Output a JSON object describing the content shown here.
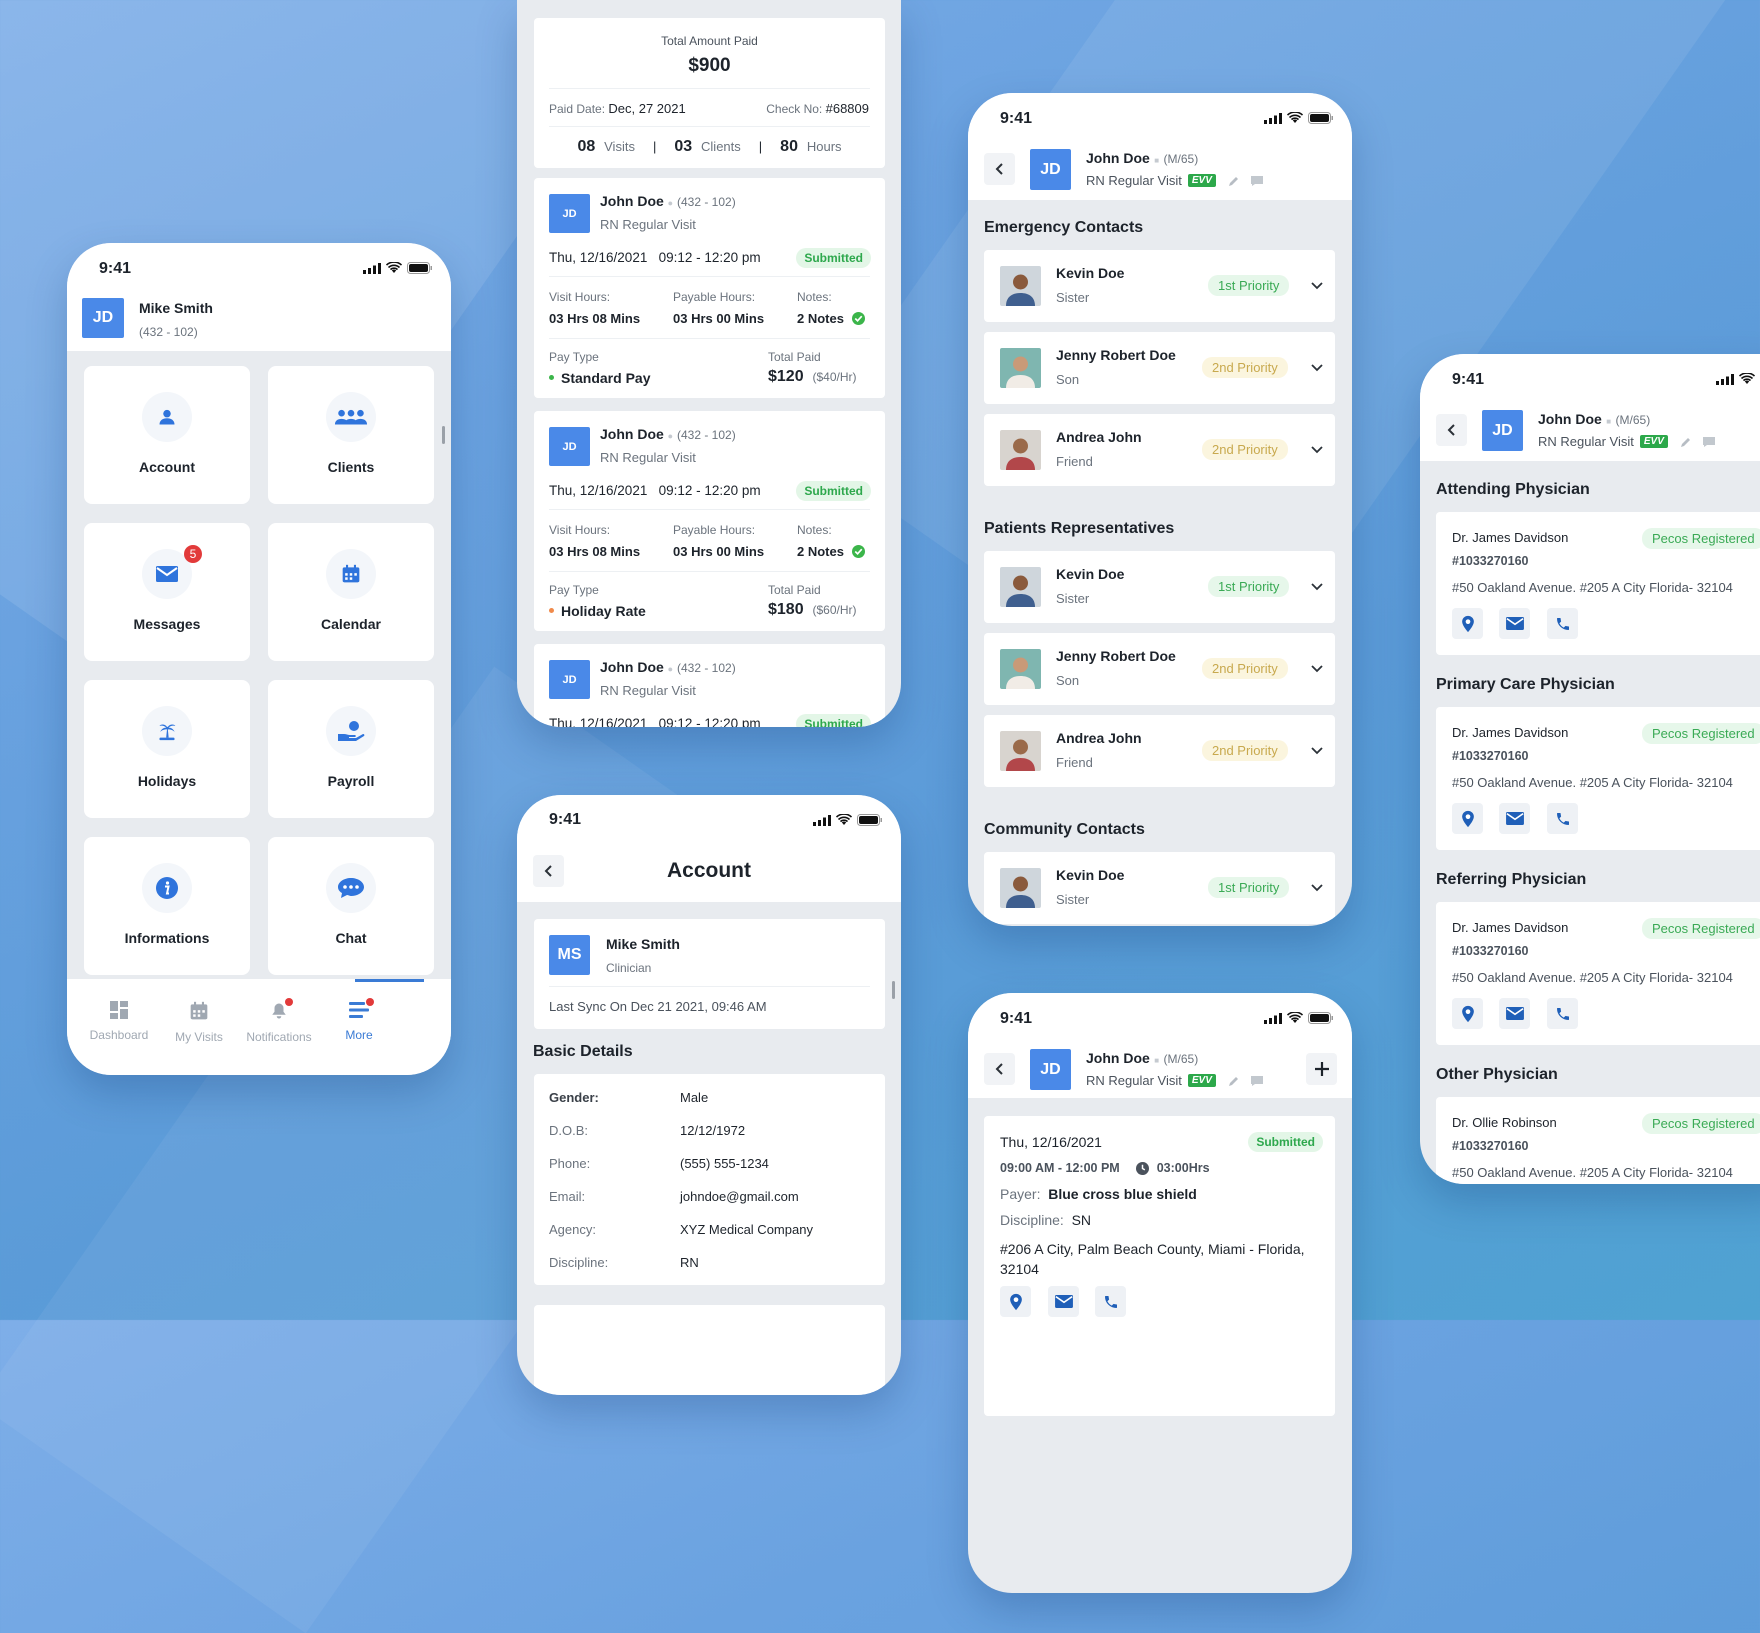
{
  "status_time": "9:41",
  "colors": {
    "accent": "#4a89e8",
    "icon_blue": "#2f74dc",
    "success": "#2ea84d",
    "warning": "#c8a94e",
    "badge_red": "#e23a3a",
    "nav_inactive": "#a0a8b2",
    "nav_active": "#3a7bd5"
  },
  "home": {
    "user": {
      "initials": "JD",
      "name": "Mike Smith",
      "id": "(432 - 102)"
    },
    "tiles": [
      {
        "label": "Account",
        "icon": "person"
      },
      {
        "label": "Clients",
        "icon": "people"
      },
      {
        "label": "Messages",
        "icon": "mail",
        "badge": "5"
      },
      {
        "label": "Calendar",
        "icon": "calendar"
      },
      {
        "label": "Holidays",
        "icon": "palm"
      },
      {
        "label": "Payroll",
        "icon": "hand-coin"
      },
      {
        "label": "Informations",
        "icon": "info"
      },
      {
        "label": "Chat",
        "icon": "chat"
      }
    ],
    "nav": [
      {
        "label": "Dashboard",
        "icon": "dashboard",
        "active": false
      },
      {
        "label": "My Visits",
        "icon": "calendar",
        "active": false
      },
      {
        "label": "Notifications",
        "icon": "bell",
        "active": false,
        "dot": true
      },
      {
        "label": "More",
        "icon": "menu",
        "active": true,
        "dot": true
      }
    ]
  },
  "payroll": {
    "summary": {
      "label": "Total Amount Paid",
      "amount": "$900",
      "paid_date_label": "Paid Date:",
      "paid_date": "Dec, 27 2021",
      "check_label": "Check No:",
      "check_no": "#68809",
      "stats": [
        {
          "value": "08",
          "label": "Visits"
        },
        {
          "value": "03",
          "label": "Clients"
        },
        {
          "value": "80",
          "label": "Hours"
        }
      ],
      "separator": "|"
    },
    "visits": [
      {
        "initials": "JD",
        "name": "John Doe",
        "id": "(432 - 102)",
        "type": "RN Regular Visit",
        "date": "Thu, 12/16/2021",
        "time": "09:12 - 12:20 pm",
        "status": "Submitted",
        "visit_hours_label": "Visit Hours:",
        "visit_hours": "03 Hrs 08 Mins",
        "payable_label": "Payable Hours:",
        "payable": "03 Hrs 00 Mins",
        "notes_label": "Notes:",
        "notes": "2 Notes",
        "pay_type_label": "Pay Type",
        "pay_type": "Standard Pay",
        "pay_type_color": "#3bb54a",
        "total_label": "Total Paid",
        "total": "$120",
        "rate": "($40/Hr)"
      },
      {
        "initials": "JD",
        "name": "John Doe",
        "id": "(432 - 102)",
        "type": "RN Regular Visit",
        "date": "Thu, 12/16/2021",
        "time": "09:12 - 12:20 pm",
        "status": "Submitted",
        "visit_hours_label": "Visit Hours:",
        "visit_hours": "03 Hrs 08 Mins",
        "payable_label": "Payable Hours:",
        "payable": "03 Hrs 00 Mins",
        "notes_label": "Notes:",
        "notes": "2 Notes",
        "pay_type_label": "Pay Type",
        "pay_type": "Holiday Rate",
        "pay_type_color": "#f08a4b",
        "total_label": "Total Paid",
        "total": "$180",
        "rate": "($60/Hr)"
      },
      {
        "initials": "JD",
        "name": "John Doe",
        "id": "(432 - 102)",
        "type": "RN Regular Visit",
        "date": "Thu, 12/16/2021",
        "time": "09:12 - 12:20 pm",
        "status": "Submitted"
      }
    ]
  },
  "account": {
    "title": "Account",
    "profile": {
      "initials": "MS",
      "name": "Mike Smith",
      "role": "Clinician",
      "sync": "Last Sync On Dec 21 2021, 09:46 AM"
    },
    "section_title": "Basic Details",
    "details": [
      {
        "label": "Gender:",
        "value": "Male"
      },
      {
        "label": "D.O.B:",
        "value": "12/12/1972"
      },
      {
        "label": "Phone:",
        "value": "(555) 555-1234"
      },
      {
        "label": "Email:",
        "value": "johndoe@gmail.com"
      },
      {
        "label": "Agency:",
        "value": "XYZ Medical Company"
      },
      {
        "label": "Discipline:",
        "value": "RN"
      }
    ]
  },
  "patient": {
    "initials": "JD",
    "name": "John Doe",
    "meta": "(M/65)",
    "visit": "RN Regular Visit",
    "evv": "EVV"
  },
  "contacts": {
    "sections": [
      {
        "title": "Emergency Contacts",
        "items": [
          {
            "name": "Kevin Doe",
            "relation": "Sister",
            "priority": "1st Priority",
            "level": "green",
            "photo": "kevin"
          },
          {
            "name": "Jenny Robert Doe",
            "relation": "Son",
            "priority": "2nd Priority",
            "level": "yellow",
            "photo": "jenny"
          },
          {
            "name": "Andrea John",
            "relation": "Friend",
            "priority": "2nd Priority",
            "level": "yellow",
            "photo": "andrea"
          }
        ]
      },
      {
        "title": "Patients Representatives",
        "items": [
          {
            "name": "Kevin Doe",
            "relation": "Sister",
            "priority": "1st Priority",
            "level": "green",
            "photo": "kevin"
          },
          {
            "name": "Jenny Robert Doe",
            "relation": "Son",
            "priority": "2nd Priority",
            "level": "yellow",
            "photo": "jenny"
          },
          {
            "name": "Andrea John",
            "relation": "Friend",
            "priority": "2nd Priority",
            "level": "yellow",
            "photo": "andrea"
          }
        ]
      },
      {
        "title": "Community Contacts",
        "items": [
          {
            "name": "Kevin Doe",
            "relation": "Sister",
            "priority": "1st Priority",
            "level": "green",
            "photo": "kevin"
          }
        ]
      }
    ]
  },
  "visit_detail": {
    "date": "Thu, 12/16/2021",
    "status": "Submitted",
    "time": "09:00 AM - 12:00 PM",
    "duration": "03:00Hrs",
    "payer_label": "Payer:",
    "payer": "Blue cross blue shield",
    "discipline_label": "Discipline:",
    "discipline": "SN",
    "address": "#206 A City, Palm Beach County, Miami - Florida, 32104"
  },
  "physicians": {
    "sections": [
      {
        "title": "Attending Physician",
        "name": "Dr. James Davidson",
        "badge": "Pecos Registered",
        "number": "#1033270160",
        "address": "#50 Oakland Avenue. #205 A City Florida- 32104"
      },
      {
        "title": "Primary Care Physician",
        "name": "Dr. James Davidson",
        "badge": "Pecos Registered",
        "number": "#1033270160",
        "address": "#50 Oakland Avenue. #205 A City Florida- 32104"
      },
      {
        "title": "Referring Physician",
        "name": "Dr. James Davidson",
        "badge": "Pecos Registered",
        "number": "#1033270160",
        "address": "#50 Oakland Avenue. #205 A City Florida- 32104"
      },
      {
        "title": "Other Physician",
        "name": "Dr. Ollie Robinson",
        "badge": "Pecos Registered",
        "number": "#1033270160",
        "address": "#50 Oakland Avenue. #205 A City Florida- 32104"
      }
    ]
  }
}
